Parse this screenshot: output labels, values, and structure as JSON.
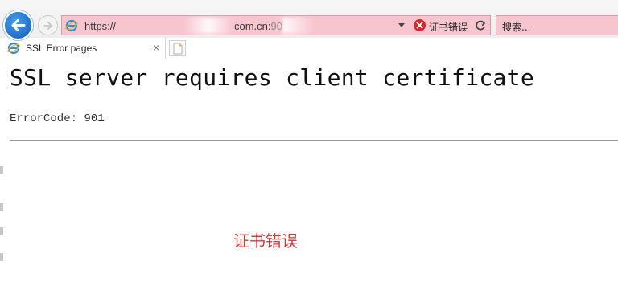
{
  "browser": {
    "address_bar": {
      "url_prefix": "https://",
      "url_domain": "com.cn:",
      "url_port": "90",
      "cert_error_label": "证书错误"
    },
    "search": {
      "placeholder": "搜索..."
    },
    "tab": {
      "label": "SSL Error pages",
      "close": "×"
    },
    "colors": {
      "address_bar_bg": "#f7c5d0",
      "cert_error": "#d8262a",
      "back_button": "#1f6fc9"
    }
  },
  "page": {
    "title": "SSL server requires client certificate",
    "error_code": "ErrorCode: 901"
  },
  "annotation": {
    "text": "证书错误",
    "color": "#d23a3a"
  }
}
